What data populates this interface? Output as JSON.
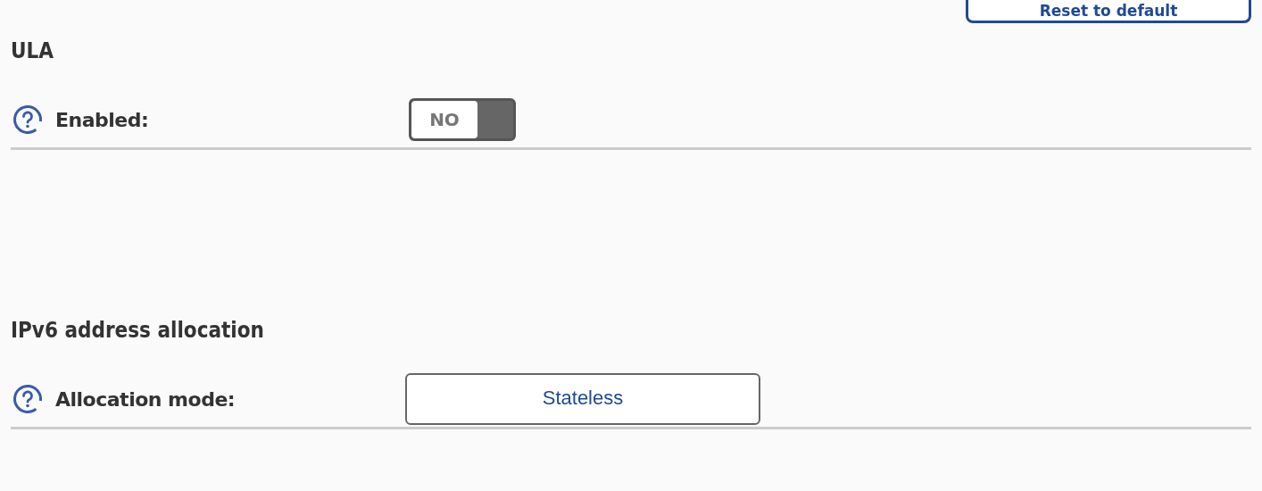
{
  "reset_button": {
    "label": "Reset to default"
  },
  "sections": [
    {
      "title": "ULA",
      "rows": [
        {
          "kind": "toggle",
          "label": "Enabled:",
          "on": false,
          "off_text": "NO",
          "on_text": ""
        }
      ]
    },
    {
      "title": "IPv6 address allocation",
      "rows": [
        {
          "kind": "select",
          "label": "Allocation mode:",
          "value": "Stateless"
        }
      ]
    }
  ]
}
